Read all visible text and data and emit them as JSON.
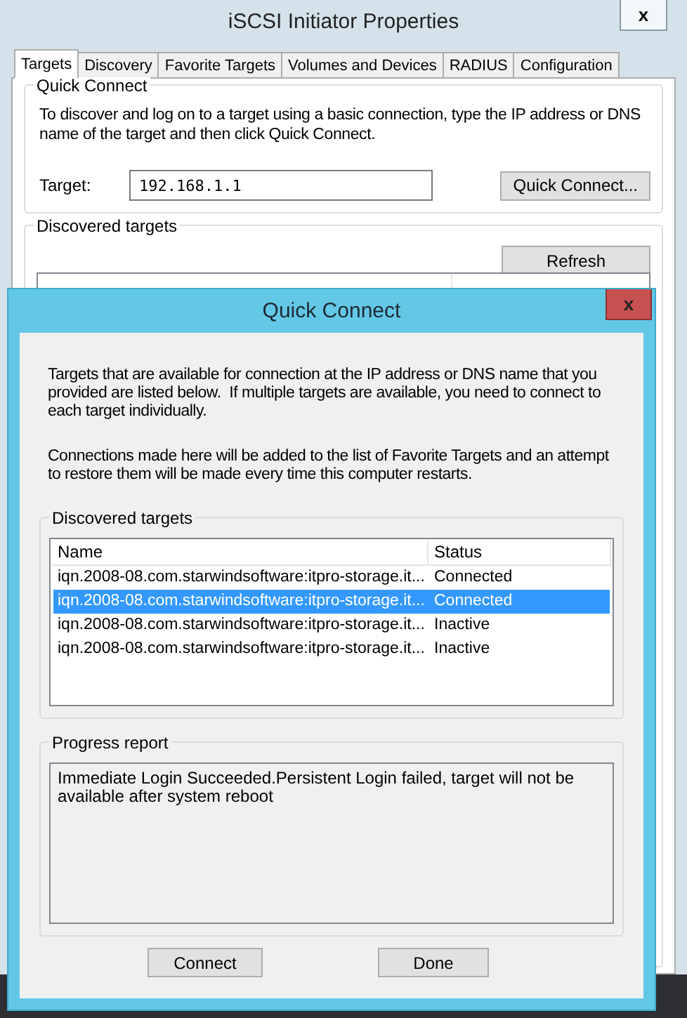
{
  "window": {
    "title": "iSCSI Initiator Properties",
    "close": "x"
  },
  "tabs": [
    {
      "label": "Targets",
      "selected": true
    },
    {
      "label": "Discovery",
      "selected": false
    },
    {
      "label": "Favorite Targets",
      "selected": false
    },
    {
      "label": "Volumes and Devices",
      "selected": false
    },
    {
      "label": "RADIUS",
      "selected": false
    },
    {
      "label": "Configuration",
      "selected": false
    }
  ],
  "quick_connect": {
    "label": "Quick Connect",
    "description": "To discover and log on to a target using a basic connection, type the IP address or DNS name of the target and then click Quick Connect.",
    "target_label": "Target:",
    "target_value": "192.168.1.1",
    "button": "Quick Connect..."
  },
  "discovered": {
    "label": "Discovered targets",
    "refresh_button": "Refresh"
  },
  "dialog": {
    "title": "Quick Connect",
    "close": "x",
    "paragraphs": [
      "Targets that are available for connection at the IP address or DNS name that you provided are listed below.  If multiple targets are available, you need to connect to each target individually.",
      "Connections made here will be added to the list of Favorite Targets and an attempt to restore them will be made every time this computer restarts."
    ],
    "targets": {
      "label": "Discovered targets",
      "columns": [
        "Name",
        "Status"
      ],
      "rows": [
        {
          "name": "iqn.2008-08.com.starwindsoftware:itpro-storage.it...",
          "status": "Connected",
          "selected": false
        },
        {
          "name": "iqn.2008-08.com.starwindsoftware:itpro-storage.it...",
          "status": "Connected",
          "selected": true
        },
        {
          "name": "iqn.2008-08.com.starwindsoftware:itpro-storage.it...",
          "status": "Inactive",
          "selected": false
        },
        {
          "name": "iqn.2008-08.com.starwindsoftware:itpro-storage.it...",
          "status": "Inactive",
          "selected": false
        }
      ]
    },
    "progress": {
      "label": "Progress report",
      "text": "Immediate Login Succeeded.Persistent Login failed, target will not be available after system reboot"
    },
    "buttons": [
      "Connect",
      "Done"
    ]
  }
}
